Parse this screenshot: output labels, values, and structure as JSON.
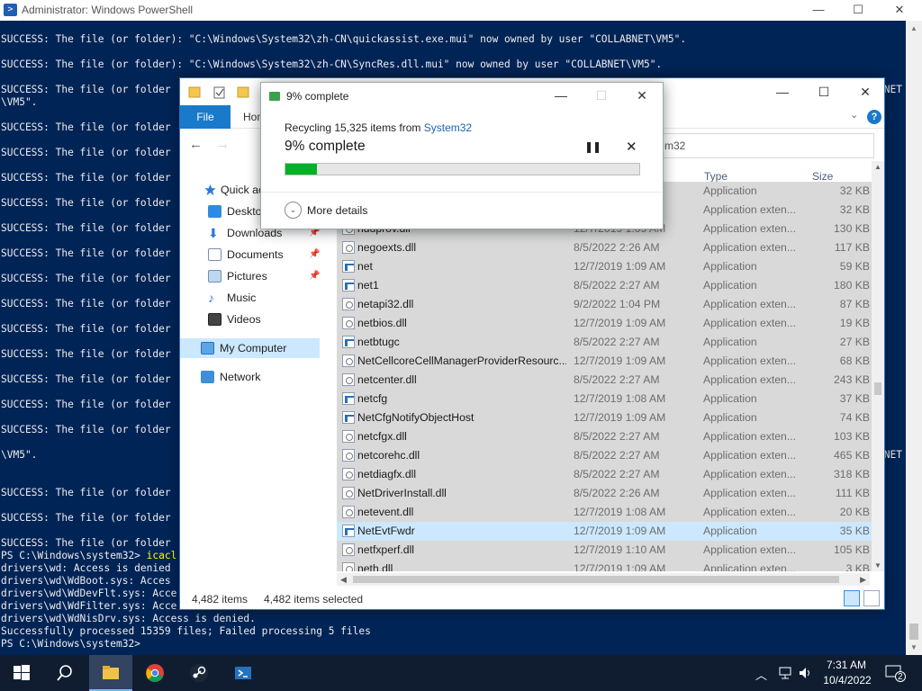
{
  "powershell": {
    "title": "Administrator: Windows PowerShell",
    "title_icon": ">",
    "controls": {
      "minimize": "—",
      "maximize": "☐",
      "close": "✕"
    },
    "lines": [
      "SUCCESS: The file (or folder): \"C:\\Windows\\System32\\zh-CN\\quickassist.exe.mui\" now owned by user \"COLLABNET\\VM5\".",
      "SUCCESS: The file (or folder): \"C:\\Windows\\System32\\zh-CN\\SyncRes.dll.mui\" now owned by user \"COLLABNET\\VM5\".",
      "SUCCESS: The file (or folder",
      "\\VM5\".",
      "SUCCESS: The file (or folder",
      "SUCCESS: The file (or folder",
      "SUCCESS: The file (or folder",
      "SUCCESS: The file (or folder",
      "SUCCESS: The file (or folder",
      "SUCCESS: The file (or folder",
      "SUCCESS: The file (or folder",
      "SUCCESS: The file (or folder",
      "SUCCESS: The file (or folder",
      "SUCCESS: The file (or folder",
      "SUCCESS: The file (or folder",
      "SUCCESS: The file (or folder",
      "SUCCESS: The file (or folder",
      "\\VM5\".",
      "SUCCESS: The file (or folder",
      "SUCCESS: The file (or folder",
      "SUCCESS: The file (or folder",
      "PS C:\\Windows\\system32> ",
      "drivers\\wd: Access is denied",
      "drivers\\wd\\WdBoot.sys: Acces",
      "drivers\\wd\\WdDevFlt.sys: Acce",
      "drivers\\wd\\WdFilter.sys: Acce",
      "drivers\\wd\\WdNisDrv.sys: Access is denied.",
      "Successfully processed 15359 files; Failed processing 5 files",
      "PS C:\\Windows\\system32>"
    ],
    "prompt_cmd": "icacl",
    "edge_fragments": [
      "NET",
      "NET"
    ]
  },
  "explorer": {
    "controls": {
      "minimize": "—",
      "maximize": "☐",
      "close": "✕"
    },
    "ribbon": {
      "file": "File",
      "home": "Hom",
      "help": "?"
    },
    "nav": {
      "back": "←",
      "forward": "→"
    },
    "search_text": "m32",
    "sidebar": [
      {
        "label": "Quick ac",
        "icon": "star-icon",
        "pinned": false
      },
      {
        "label": "Deskto",
        "icon": "desktop-icon",
        "pinned": false
      },
      {
        "label": "Downloads",
        "icon": "download-icon",
        "pinned": true
      },
      {
        "label": "Documents",
        "icon": "document-icon",
        "pinned": true
      },
      {
        "label": "Pictures",
        "icon": "picture-icon",
        "pinned": true
      },
      {
        "label": "Music",
        "icon": "music-icon",
        "pinned": false
      },
      {
        "label": "Videos",
        "icon": "video-icon",
        "pinned": false
      },
      {
        "label": "My Computer",
        "icon": "computer-icon",
        "pinned": false
      },
      {
        "label": "Network",
        "icon": "network-icon",
        "pinned": false
      }
    ],
    "columns": {
      "type": "Type",
      "size": "Size"
    },
    "files": [
      {
        "name": "",
        "date": "",
        "type": "Application",
        "size": "32 KB",
        "kind": "app"
      },
      {
        "name": "",
        "date": "",
        "type": "Application exten...",
        "size": "32 KB",
        "kind": "dll"
      },
      {
        "name": "nduprov.dll",
        "date": "12/7/2019 1:09 AM",
        "type": "Application exten...",
        "size": "130 KB",
        "kind": "dll"
      },
      {
        "name": "negoexts.dll",
        "date": "8/5/2022 2:26 AM",
        "type": "Application exten...",
        "size": "117 KB",
        "kind": "dll"
      },
      {
        "name": "net",
        "date": "12/7/2019 1:09 AM",
        "type": "Application",
        "size": "59 KB",
        "kind": "app"
      },
      {
        "name": "net1",
        "date": "8/5/2022 2:27 AM",
        "type": "Application",
        "size": "180 KB",
        "kind": "app"
      },
      {
        "name": "netapi32.dll",
        "date": "9/2/2022 1:04 PM",
        "type": "Application exten...",
        "size": "87 KB",
        "kind": "dll"
      },
      {
        "name": "netbios.dll",
        "date": "12/7/2019 1:09 AM",
        "type": "Application exten...",
        "size": "19 KB",
        "kind": "dll"
      },
      {
        "name": "netbtugc",
        "date": "8/5/2022 2:27 AM",
        "type": "Application",
        "size": "27 KB",
        "kind": "app"
      },
      {
        "name": "NetCellcoreCellManagerProviderResourc...",
        "date": "12/7/2019 1:09 AM",
        "type": "Application exten...",
        "size": "68 KB",
        "kind": "dll"
      },
      {
        "name": "netcenter.dll",
        "date": "8/5/2022 2:27 AM",
        "type": "Application exten...",
        "size": "243 KB",
        "kind": "dll"
      },
      {
        "name": "netcfg",
        "date": "12/7/2019 1:08 AM",
        "type": "Application",
        "size": "37 KB",
        "kind": "app"
      },
      {
        "name": "NetCfgNotifyObjectHost",
        "date": "12/7/2019 1:09 AM",
        "type": "Application",
        "size": "74 KB",
        "kind": "app"
      },
      {
        "name": "netcfgx.dll",
        "date": "8/5/2022 2:27 AM",
        "type": "Application exten...",
        "size": "103 KB",
        "kind": "dll"
      },
      {
        "name": "netcorehc.dll",
        "date": "8/5/2022 2:27 AM",
        "type": "Application exten...",
        "size": "465 KB",
        "kind": "dll"
      },
      {
        "name": "netdiagfx.dll",
        "date": "8/5/2022 2:27 AM",
        "type": "Application exten...",
        "size": "318 KB",
        "kind": "dll"
      },
      {
        "name": "NetDriverInstall.dll",
        "date": "8/5/2022 2:26 AM",
        "type": "Application exten...",
        "size": "111 KB",
        "kind": "dll"
      },
      {
        "name": "netevent.dll",
        "date": "12/7/2019 1:08 AM",
        "type": "Application exten...",
        "size": "20 KB",
        "kind": "dll"
      },
      {
        "name": "NetEvtFwdr",
        "date": "12/7/2019 1:09 AM",
        "type": "Application",
        "size": "35 KB",
        "kind": "app"
      },
      {
        "name": "netfxperf.dll",
        "date": "12/7/2019 1:10 AM",
        "type": "Application exten...",
        "size": "105 KB",
        "kind": "dll"
      },
      {
        "name": "neth.dll",
        "date": "12/7/2019 1:09 AM",
        "type": "Application exten...",
        "size": "3 KB",
        "kind": "dll"
      }
    ],
    "highlighted_file": "NetEvtFwdr",
    "status": {
      "items": "4,482 items",
      "selected": "4,482 items selected"
    }
  },
  "dialog": {
    "title": "9% complete",
    "recycling_prefix": "Recycling 15,325 items from ",
    "recycling_source": "System32",
    "percent_text": "9% complete",
    "progress": 0.09,
    "pause": "❚❚",
    "cancel": "✕",
    "more_details": "More details",
    "expand_glyph": "⌄",
    "controls": {
      "minimize": "—",
      "maximize": "☐",
      "close": "✕"
    },
    "progress_color": "#06b025"
  },
  "taskbar": {
    "time": "7:31 AM",
    "date": "10/4/2022",
    "notification_count": "2",
    "tray_chevron": "︿"
  }
}
